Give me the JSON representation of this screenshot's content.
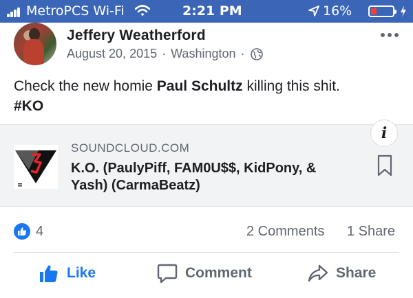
{
  "status_bar": {
    "carrier": "MetroPCS Wi-Fi",
    "time": "2:21 PM",
    "battery": "16%"
  },
  "post": {
    "author": "Jeffery Weatherford",
    "date": "August 20, 2015",
    "location": "Washington",
    "text_before": "Check the new homie ",
    "tagged": "Paul Schultz",
    "text_after": " killing this shit.",
    "hashtag": "#KO"
  },
  "link_preview": {
    "domain": "SOUNDCLOUD.COM",
    "title": "K.O. (PaulyPiff, FAM0U$$, KidPony, & Yash) (CarmaBeatz)",
    "info_glyph": "i"
  },
  "engagement": {
    "likes": "4",
    "comments": "2 Comments",
    "shares": "1 Share"
  },
  "actions": {
    "like": "Like",
    "comment": "Comment",
    "share": "Share"
  },
  "colors": {
    "status_bar": "#3b66b8",
    "facebook_blue": "#1877f2",
    "secondary_text": "#606770",
    "card_background": "#f2f3f5"
  }
}
